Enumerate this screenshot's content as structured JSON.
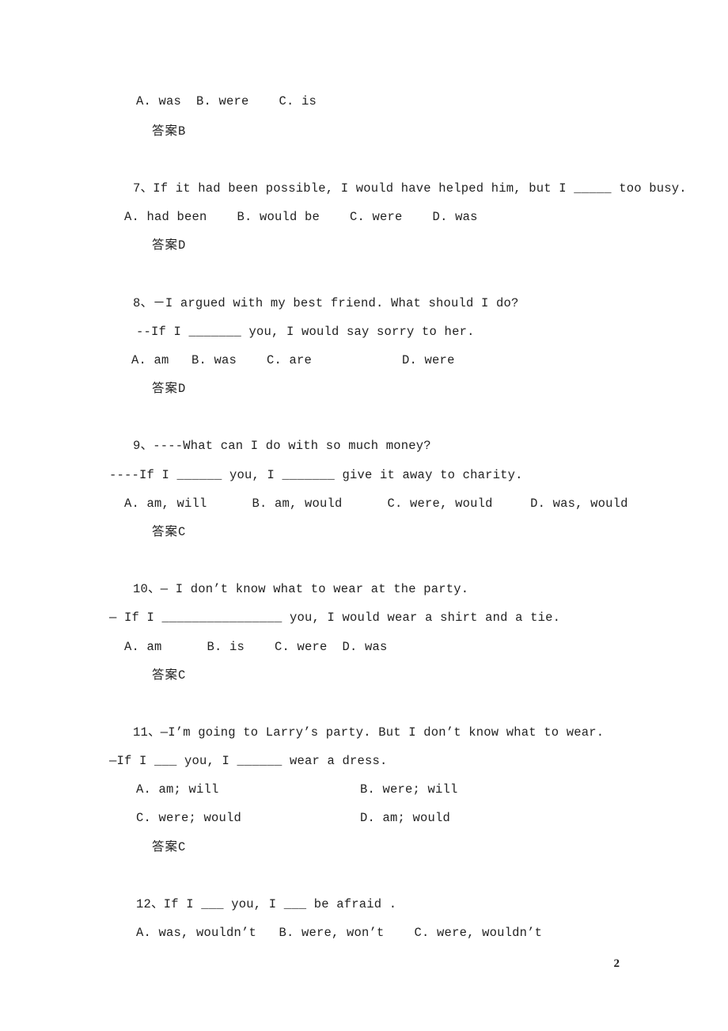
{
  "document": {
    "page_number": "2",
    "type": "grammar-exercise-worksheet",
    "answer_label": "答案"
  },
  "carryover": {
    "options": "A. was  B. were    C. is",
    "answer_prefix": "答案",
    "answer_value": "B"
  },
  "questions": [
    {
      "number": "7",
      "stem": "7、If it had been possible, I would have helped him, but I _____ too busy.",
      "options_lines": [
        "A. had been    B. would be    C. were    D. was"
      ],
      "answer_prefix": "答案",
      "answer_value": "D"
    },
    {
      "number": "8",
      "stem": "8、－I argued with my best friend. What should I do?",
      "stem_continued": "--If I _______ you, I would say sorry to her.",
      "options_lines": [
        "A. am   B. was    C. are            D. were"
      ],
      "answer_prefix": "答案",
      "answer_value": "D"
    },
    {
      "number": "9",
      "stem": "9、----What can I do with so much money?",
      "stem_continued": "----If I ______ you, I _______ give it away to charity.",
      "options_lines": [
        "A. am, will      B. am, would      C. were, would     D. was, would"
      ],
      "answer_prefix": "答案",
      "answer_value": "C"
    },
    {
      "number": "10",
      "stem": "10、— I don’t know what to wear at the party.",
      "stem_continued": "— If I ________________ you, I would wear a shirt and a tie.",
      "options_lines": [
        "A. am      B. is    C. were  D. was"
      ],
      "answer_prefix": "答案",
      "answer_value": "C"
    },
    {
      "number": "11",
      "stem": "11、—I’m going to Larry’s party. But I don’t know what to wear.",
      "stem_continued": "—If I ___ you, I ______ wear a dress.",
      "options_col1": [
        "A. am; will",
        "C. were; would"
      ],
      "options_col2": [
        "B. were; will",
        "D. am; would"
      ],
      "answer_prefix": "答案",
      "answer_value": "C"
    },
    {
      "number": "12",
      "stem": "12、If I ___ you, I ___ be afraid .",
      "options_lines": [
        "A. was, wouldn’t   B. were, won’t    C. were, wouldn’t"
      ]
    }
  ]
}
